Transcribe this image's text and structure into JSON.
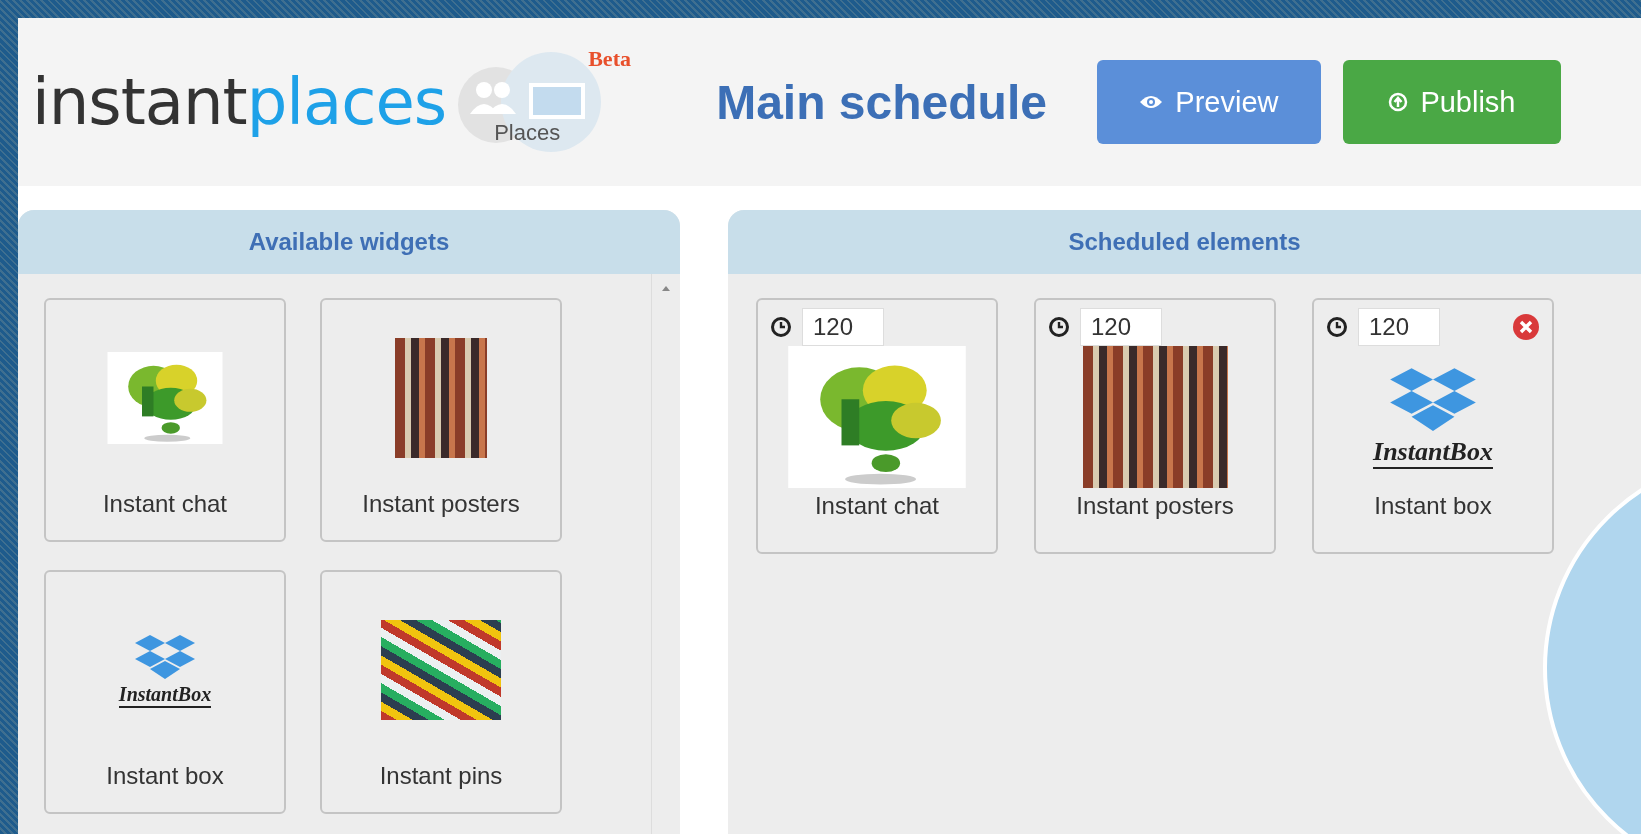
{
  "header": {
    "logo_dark": "instant",
    "logo_light": "places",
    "places_label": "Places",
    "beta": "Beta",
    "title": "Main schedule",
    "buttons": [
      {
        "kind": "preview",
        "label": "Preview"
      },
      {
        "kind": "publish",
        "label": "Publish"
      }
    ]
  },
  "available": {
    "title": "Available widgets",
    "widgets": [
      {
        "kind": "chat",
        "label": "Instant chat"
      },
      {
        "kind": "posters",
        "label": "Instant posters"
      },
      {
        "kind": "box",
        "label": "Instant box",
        "logo_text": "InstantBox"
      },
      {
        "kind": "pins",
        "label": "Instant pins"
      }
    ]
  },
  "scheduled": {
    "title": "Scheduled elements",
    "elements": [
      {
        "kind": "chat",
        "label": "Instant chat",
        "duration": "120",
        "removable": false
      },
      {
        "kind": "posters",
        "label": "Instant posters",
        "duration": "120",
        "removable": false
      },
      {
        "kind": "box",
        "label": "Instant box",
        "logo_text": "InstantBox",
        "duration": "120",
        "removable": true
      }
    ]
  }
}
